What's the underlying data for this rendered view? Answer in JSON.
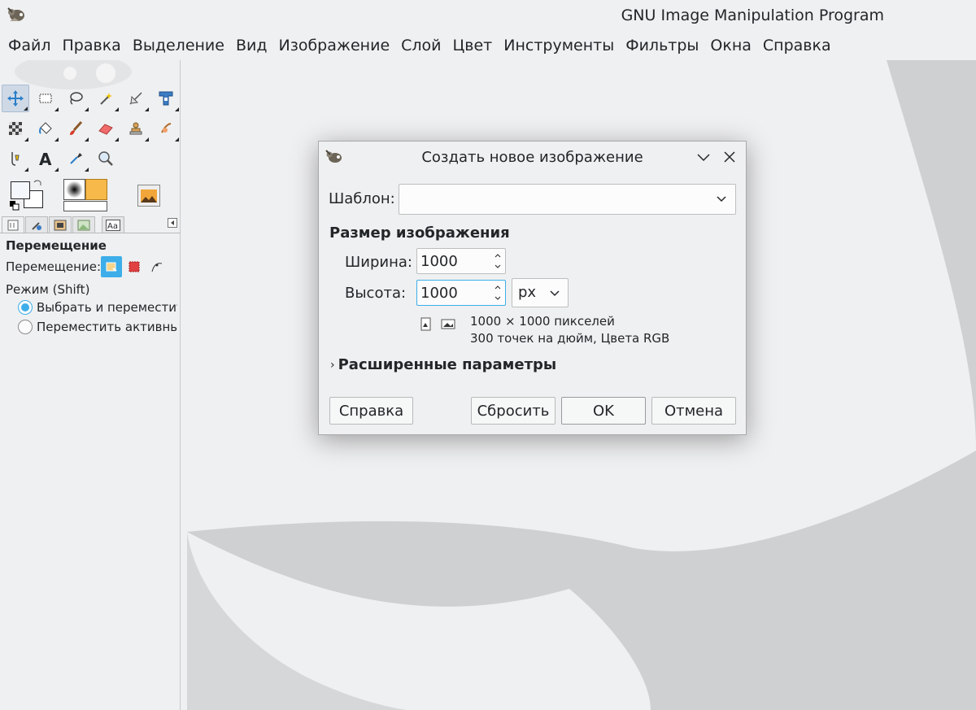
{
  "window": {
    "title": "GNU Image Manipulation Program"
  },
  "menubar": {
    "items": [
      "Файл",
      "Правка",
      "Выделение",
      "Вид",
      "Изображение",
      "Слой",
      "Цвет",
      "Инструменты",
      "Фильтры",
      "Окна",
      "Справка"
    ]
  },
  "toolbox": {
    "tools": [
      {
        "icon": "move-tool-icon",
        "active": true
      },
      {
        "icon": "rect-select-icon"
      },
      {
        "icon": "lasso-icon"
      },
      {
        "icon": "fuzzy-select-icon"
      },
      {
        "icon": "crop-icon"
      },
      {
        "icon": "unified-transform-icon"
      },
      {
        "icon": "gradient-icon"
      },
      {
        "icon": "bucket-fill-icon"
      },
      {
        "icon": "paintbrush-icon"
      },
      {
        "icon": "eraser-icon"
      },
      {
        "icon": "clone-icon"
      },
      {
        "icon": "smudge-icon"
      },
      {
        "icon": "paths-icon"
      },
      {
        "icon": "text-icon"
      },
      {
        "icon": "color-picker-icon"
      },
      {
        "icon": "zoom-icon"
      }
    ],
    "colors": {
      "foreground": "#f4f8fc",
      "background": "#ffffff",
      "brush_color": "#f6b94a"
    }
  },
  "tool_options": {
    "title": "Перемещение",
    "move_label": "Перемещение:",
    "mode_label": "Режим (Shift)",
    "radio_pick": "Выбрать и переместит",
    "radio_active": "Переместить активны"
  },
  "dialog": {
    "title": "Создать новое изображение",
    "template_label": "Шаблон:",
    "template_value": "",
    "section_size": "Размер изображения",
    "width_label": "Ширина:",
    "width_value": "1000",
    "height_label": "Высота:",
    "height_value": "1000",
    "unit": "px",
    "info_pixels": "1000 × 1000 пикселей",
    "info_res": "300 точек на дюйм, Цвета RGB",
    "advanced": "Расширенные параметры",
    "buttons": {
      "help": "Справка",
      "reset": "Сбросить",
      "ok": "OK",
      "cancel": "Отмена"
    }
  },
  "accent": "#3daee9"
}
